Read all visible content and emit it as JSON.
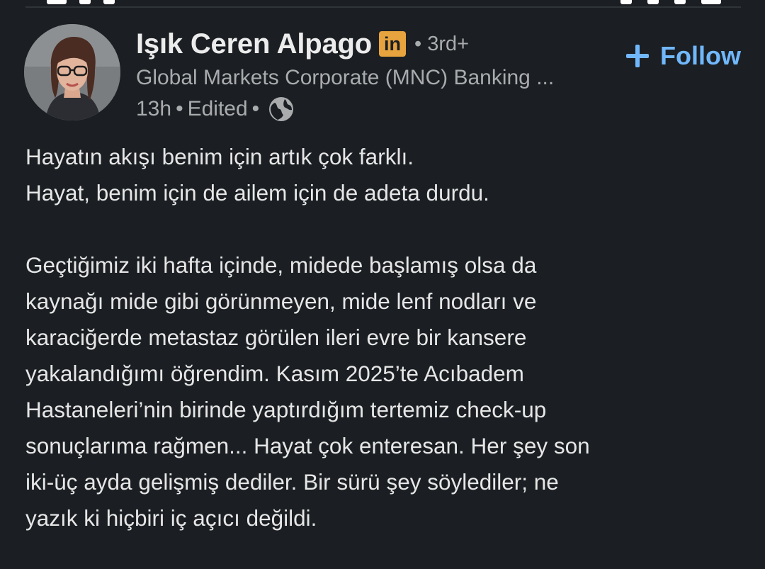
{
  "post": {
    "author": {
      "name": "Işık Ceren Alpago",
      "badge": "in",
      "degree": "• 3rd+",
      "headline": "Global Markets Corporate (MNC) Banking ...",
      "time": "13h",
      "edited": "Edited"
    },
    "follow_label": "Follow",
    "body": {
      "paragraph1": [
        "Hayatın akışı benim için artık çok farklı.",
        "Hayat, benim için de ailem için de adeta durdu."
      ],
      "paragraph2": [
        "Geçtiğimiz iki hafta içinde, midede başlamış olsa da",
        "kaynağı mide gibi görünmeyen, mide lenf nodları ve",
        "karaciğerde metastaz görülen ileri evre bir kansere",
        "yakalandığımı öğrendim. Kasım 2025’te Acıbadem",
        "Hastaneleri’nin birinde yaptırdığım tertemiz check-up",
        "sonuçlarıma rağmen... Hayat çok enteresan. Her şey son",
        "iki-üç ayda gelişmiş dediler. Bir sürü şey söylediler; ne",
        "yazık ki hiçbiri iç açıcı değildi."
      ]
    }
  },
  "icons": {
    "badge": "linkedin-icon",
    "visibility": "globe-icon",
    "follow": "plus-icon"
  },
  "colors": {
    "background": "#1b1f23",
    "accent": "#71b7fb",
    "badge": "#e7a33e",
    "secondary_text": "#a9abad"
  }
}
